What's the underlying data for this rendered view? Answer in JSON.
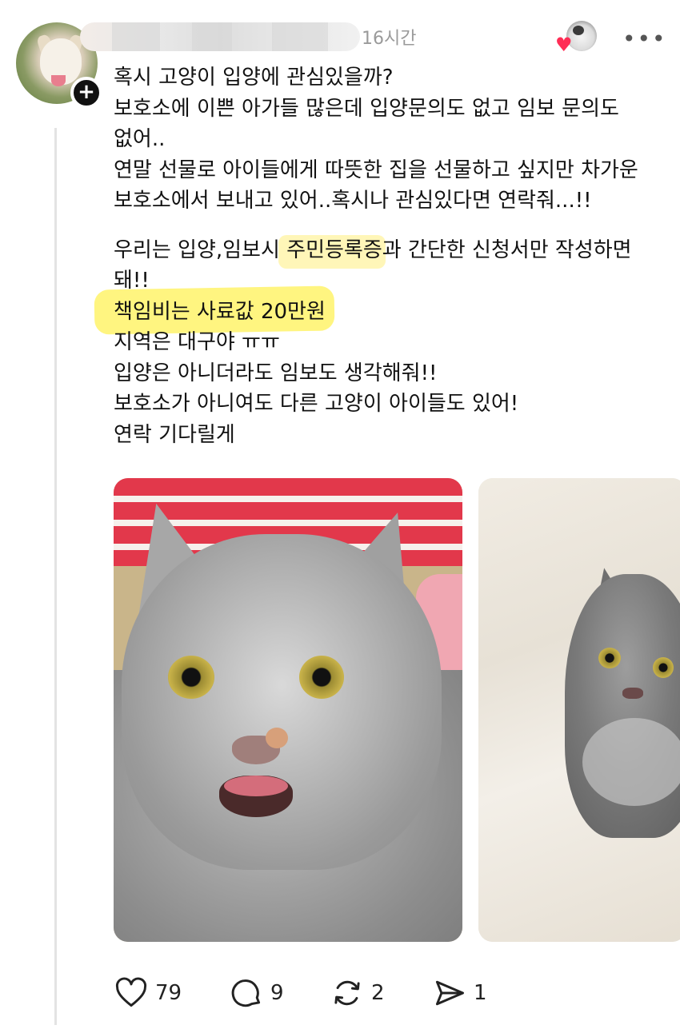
{
  "post": {
    "timestamp": "16시간",
    "lines": [
      "혹시 고양이 입양에 관심있을까?",
      "보호소에 이쁜 아가들 많은데 입양문의도 없고 임보 문의도",
      "없어..",
      "연말 선물로 아이들에게 따뜻한 집을 선물하고 싶지만 차가운",
      "보호소에서 보내고 있어..혹시나 관심있다면 연락줘...!!"
    ],
    "lines2": [
      "우리는 입양,임보시 주민등록증과 간단한 신청서만 작성하면",
      "돼!!",
      "책임비는 사료값 20만원",
      "지역은 대구야 ㅠㅠ",
      "입양은 아니더라도 임보도 생각해줘!!",
      "보호소가 아니여도 다른 고양이 아이들도 있어!",
      "연락 기다릴게"
    ]
  },
  "actions": {
    "likes": "79",
    "replies": "9",
    "reposts": "2",
    "shares": "1"
  },
  "icons": {
    "follow": "plus-icon",
    "liked": "heart-icon",
    "more": "more-dots-icon",
    "like": "heart-outline-icon",
    "reply": "comment-bubble-icon",
    "repost": "repost-icon",
    "share": "send-icon"
  },
  "colors": {
    "highlight_light": "#fff6b8",
    "highlight_strong": "#fff36a",
    "liked_heart": "#ff2d55",
    "thread_line": "#e3e3e3",
    "timestamp": "#9a9a9a"
  }
}
